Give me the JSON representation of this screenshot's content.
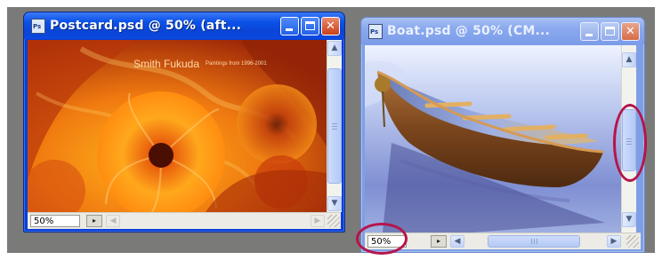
{
  "colors": {
    "workspace": "#7a7a79",
    "title_active": "#0b52e8",
    "title_inactive": "#7b9ce9",
    "callout": "#b5154b"
  },
  "windows": [
    {
      "id": "postcard",
      "title": "Postcard.psd @ 50% (aft...",
      "zoom": "50%",
      "state": "active",
      "image_text": {
        "name": "Smith Fukuda",
        "subtitle": "Paintings from 1996-2001"
      },
      "buttons": {
        "minimize": "minimize-icon",
        "maximize": "maximize-icon",
        "close": "close-icon"
      }
    },
    {
      "id": "boat",
      "title": "Boat.psd @ 50% (CM...",
      "zoom": "50%",
      "state": "inactive",
      "buttons": {
        "minimize": "minimize-icon",
        "maximize": "maximize-icon",
        "close": "close-icon"
      }
    }
  ],
  "glyphs": {
    "close": "✕",
    "scroll_up": "▲",
    "scroll_down": "▼",
    "scroll_left": "◀",
    "scroll_right": "▶",
    "status_menu": "▸"
  },
  "callouts": [
    "vertical-scrollbar-thumb",
    "zoom-level-field"
  ]
}
